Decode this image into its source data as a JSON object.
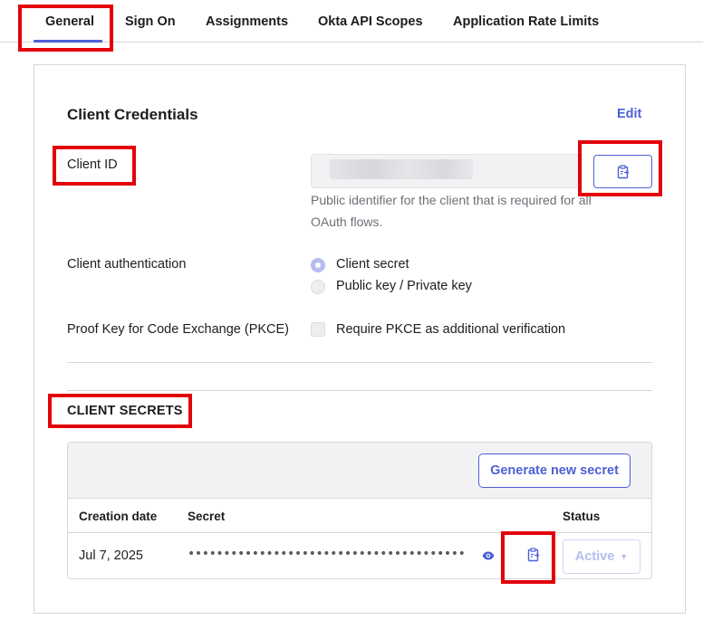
{
  "tabs": [
    {
      "label": "General",
      "active": true
    },
    {
      "label": "Sign On"
    },
    {
      "label": "Assignments"
    },
    {
      "label": "Okta API Scopes"
    },
    {
      "label": "Application Rate Limits"
    }
  ],
  "credentials": {
    "title": "Client Credentials",
    "edit_label": "Edit",
    "client_id_label": "Client ID",
    "client_id_help": "Public identifier for the client that is required for all OAuth flows.",
    "auth_label": "Client authentication",
    "auth_options": [
      {
        "label": "Client secret",
        "selected": true
      },
      {
        "label": "Public key / Private key",
        "selected": false
      }
    ],
    "pkce_label": "Proof Key for Code Exchange (PKCE)",
    "pkce_option": "Require PKCE as additional verification",
    "pkce_checked": false
  },
  "secrets": {
    "title": "CLIENT SECRETS",
    "generate_label": "Generate new secret",
    "columns": [
      "Creation date",
      "Secret",
      "Status"
    ],
    "rows": [
      {
        "creation_date": "Jul 7, 2025",
        "secret": "•••••••••••••••••••••••••••••••••••••••",
        "status": "Active"
      }
    ]
  },
  "colors": {
    "accent": "#4d5fd6",
    "highlight": "#e3000b",
    "muted_accent": "#b6bdf0"
  }
}
